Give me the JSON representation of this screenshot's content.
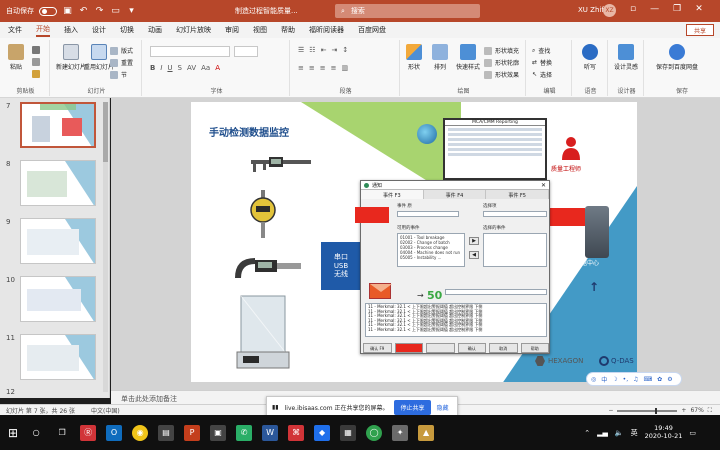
{
  "titlebar": {
    "autosave_label": "自动保存",
    "autosave_state": "关",
    "document_title": "制造过程智能质量...",
    "search_placeholder": "搜索",
    "user_name": "XU Zhifu",
    "user_initials": "XZ"
  },
  "menu": {
    "tabs": [
      "文件",
      "开始",
      "插入",
      "设计",
      "切换",
      "动画",
      "幻灯片放映",
      "审阅",
      "视图",
      "帮助",
      "福昕阅读器",
      "百度网盘"
    ],
    "active": "开始",
    "share_label": "共享"
  },
  "ribbon": {
    "groups": {
      "clipboard": "剪贴板",
      "slides": "幻灯片",
      "font": "字体",
      "paragraph": "段落",
      "drawing": "绘图",
      "editing": "编辑",
      "voice": "语音",
      "designer": "设计器",
      "save": "保存"
    },
    "buttons": {
      "paste": "粘贴",
      "new_slide": "新建幻灯片",
      "reuse_slide": "重用幻灯片",
      "layout": "版式",
      "reset": "重置",
      "section": "节",
      "shape": "形状",
      "arrange": "排列",
      "quick_styles": "快速样式",
      "shape_fill": "形状填充",
      "shape_outline": "形状轮廓",
      "shape_effects": "形状效果",
      "find": "查找",
      "replace": "替换",
      "select": "选择",
      "dictate": "听写",
      "design_ideas": "设计灵感",
      "save_baidu": "保存到百度网盘"
    }
  },
  "thumbnails": [
    {
      "num": "7",
      "active": true
    },
    {
      "num": "8",
      "active": false
    },
    {
      "num": "9",
      "active": false
    },
    {
      "num": "10",
      "active": false
    },
    {
      "num": "11",
      "active": false
    },
    {
      "num": "12",
      "active": false
    }
  ],
  "slide": {
    "title": "手动检测数据监控",
    "usb_lines": [
      "串口",
      "USB",
      "无线"
    ],
    "report_title": "MCA/CMM Reporting",
    "engineer_label": "质量工程师",
    "datacenter_label": "数据中心",
    "logo_hexagon": "HEXAGON",
    "logo_qdas": "Q-DAS"
  },
  "dialog": {
    "title": "通知",
    "tabs": [
      "事件 F3",
      "事件 F4",
      "事件 F5"
    ],
    "field1_label": "事件 原",
    "field2_label": "选择项",
    "list_label": "可用的事件",
    "events": [
      "01001 - Tool breakage",
      "02002 - Change of batch",
      "03003 - Process change",
      "04004 - Machine does not run",
      "05005 - Instability ..."
    ],
    "selected_label": "选择的事件",
    "value": "50",
    "log_lines": [
      "11 - Merkmal: 32.1 < 上下限超出警报阈值  超出控制界限  下侧",
      "11 - Merkmal: 32.1 < 上下限超出警报阈值  超出控制界限  下侧",
      "11 - Merkmal: 32.1 < 上下限超出警报阈值  超出控制界限  下侧",
      "11 - Merkmal: 32.1 < 上下限超出警报阈值  超出控制界限  下侧",
      "11 - Merkmal: 32.1 < 上下限超出警报阈值  超出控制界限  下侧",
      "11 - Merkmal: 32.1 < 上下限超出警报阈值  超出控制界限  下侧"
    ],
    "footer_buttons": [
      "确认 F9",
      "",
      "",
      "确认",
      "取消",
      "帮助"
    ]
  },
  "notes": {
    "placeholder": "单击此处添加备注"
  },
  "status": {
    "slide_info": "幻灯片 第 7 张，共 26 张",
    "language": "中文(中国)",
    "zoom": "67%"
  },
  "toast": {
    "message": "live.ibisaas.com 正在共享您的屏幕。",
    "stop_label": "停止共享",
    "hide_label": "隐藏"
  },
  "ime": {
    "lang": "中"
  },
  "taskbar": {
    "time": "19:49",
    "date": "2020-10-21",
    "input_lang": "英"
  }
}
